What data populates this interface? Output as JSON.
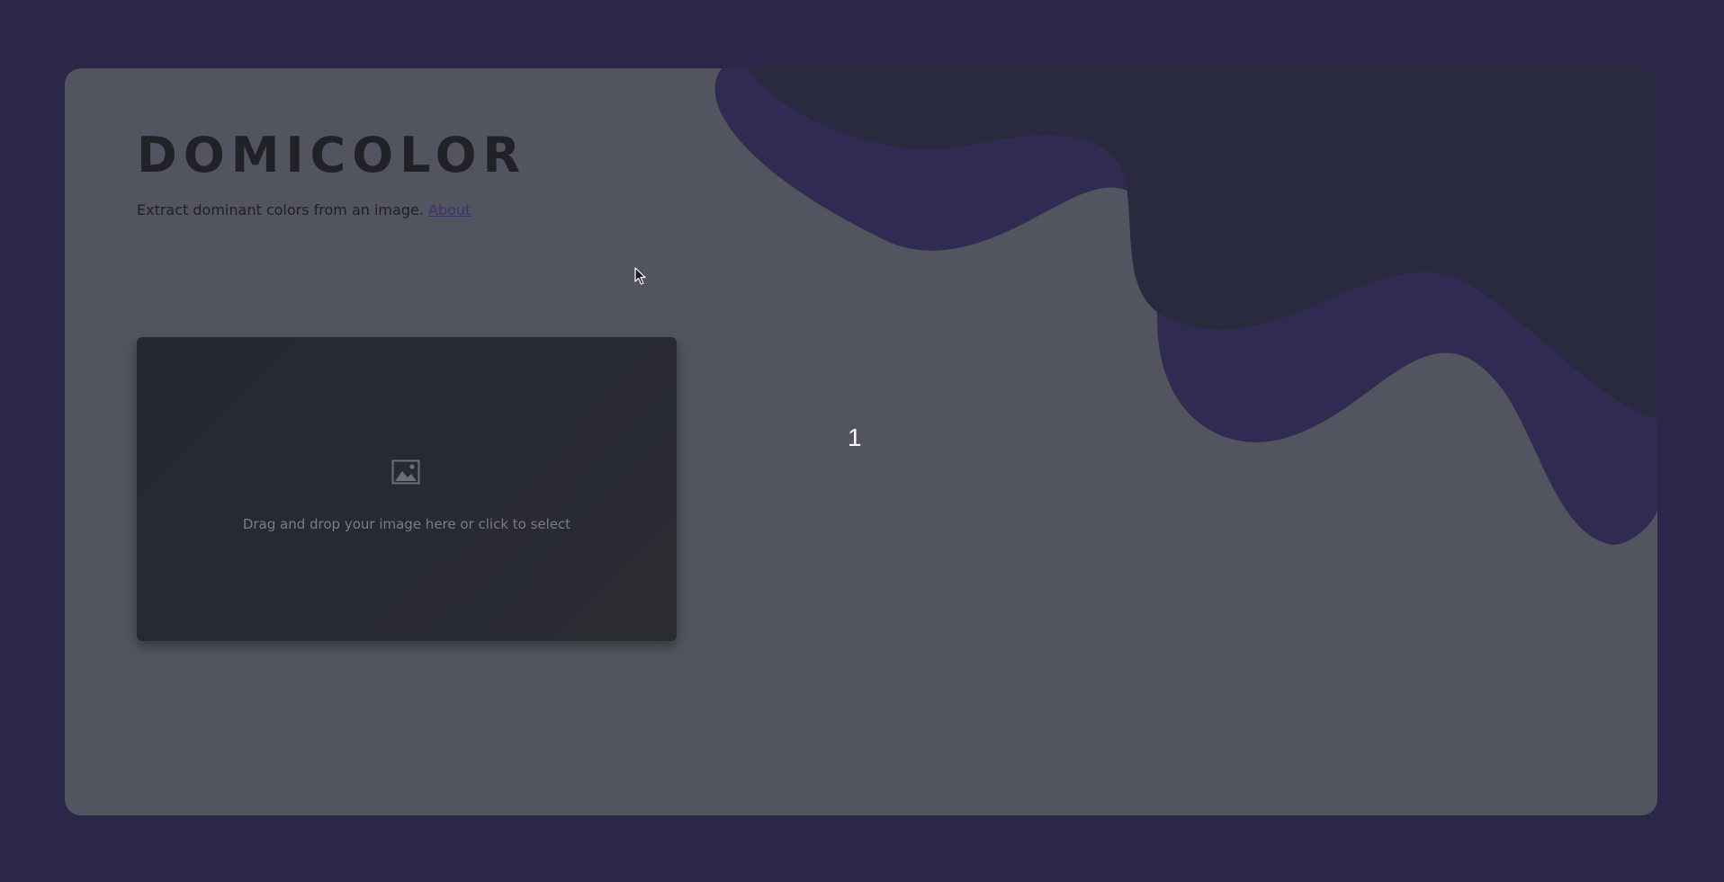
{
  "app": {
    "title": "DOMICOLOR",
    "subtitle": "Extract dominant colors from an image.",
    "about_label": "About"
  },
  "dropzone": {
    "text": "Drag and drop your image here or click to select",
    "icon": "image-icon"
  },
  "step": {
    "number": "1"
  },
  "colors": {
    "page_background": "#2b2748",
    "card_background": "#52555f",
    "wave_dark": "#2a2a3f",
    "wave_purple": "#312a52",
    "dropzone_background": "#272a32",
    "title": "#212227",
    "link": "#3c3470"
  }
}
